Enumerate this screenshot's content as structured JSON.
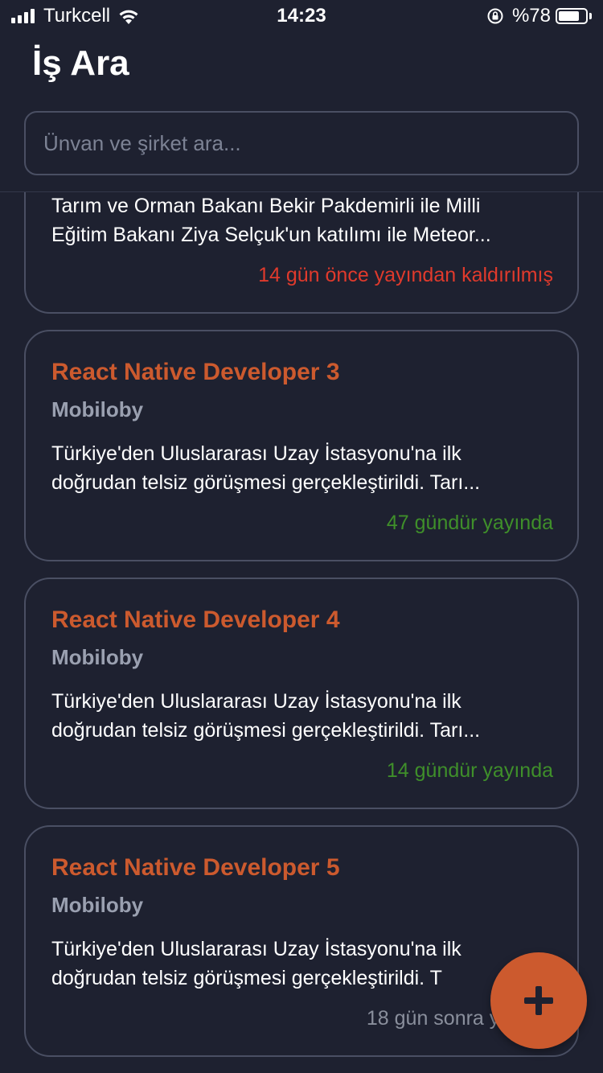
{
  "status_bar": {
    "carrier": "Turkcell",
    "time": "14:23",
    "battery_percent": "%78",
    "battery_level": 0.78,
    "icons": [
      "signal-icon",
      "wifi-icon",
      "rotation-lock-icon",
      "battery-icon"
    ]
  },
  "header": {
    "title": "İş Ara"
  },
  "search": {
    "placeholder": "Ünvan ve şirket ara...",
    "value": ""
  },
  "jobs": [
    {
      "title": "",
      "company": "",
      "description_line1": "Tarım ve Orman Bakanı Bekir Pakdemirli ile Milli",
      "description_line2": "Eğitim Bakanı Ziya Selçuk'un katılımı ile Meteor...",
      "status": "14 gün önce yayından kaldırılmış",
      "status_color": "#e03a2c"
    },
    {
      "title": "React Native Developer 3",
      "company": "Mobiloby",
      "description_line1": "Türkiye'den Uluslararası Uzay İstasyonu'na ilk",
      "description_line2": "doğrudan telsiz görüşmesi gerçekleştirildi. Tarı...",
      "status": "47 gündür yayında",
      "status_color": "#3f8f2a"
    },
    {
      "title": "React Native Developer 4",
      "company": "Mobiloby",
      "description_line1": "Türkiye'den Uluslararası Uzay İstasyonu'na ilk",
      "description_line2": "doğrudan telsiz görüşmesi gerçekleştirildi. Tarı...",
      "status": "14 gündür yayında",
      "status_color": "#3f8f2a"
    },
    {
      "title": "React Native Developer 5",
      "company": "Mobiloby",
      "description_line1": "Türkiye'den Uluslararası Uzay İstasyonu'na ilk",
      "description_line2": "doğrudan telsiz görüşmesi gerçekleştirildi. T",
      "status": "18 gün sonra yayınla",
      "status_color": "#8a8f9c"
    }
  ],
  "fab": {
    "icon": "plus-icon",
    "color": "#cc5a2e"
  },
  "colors": {
    "background": "#1e2130",
    "accent": "#cc5a2e",
    "border": "#4a4f63",
    "muted": "#9aa0b0"
  }
}
